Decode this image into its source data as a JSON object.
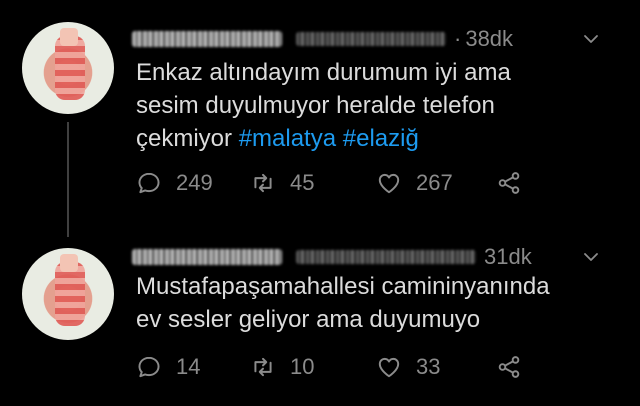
{
  "tweets": [
    {
      "author_name_blurred": "",
      "handle_blurred": "",
      "separator": "·",
      "time": "38dk",
      "text": {
        "line1": "Enkaz altındayım durumum iyi ama",
        "line2": "sesim duyulmuyor heralde telefon",
        "line3_prefix": "çekmiyor ",
        "hashtag1": "#malatya",
        "space": " ",
        "hashtag2": "#elaziğ"
      },
      "replies": "249",
      "retweets": "45",
      "likes": "267"
    },
    {
      "author_name_blurred": "",
      "handle_blurred": "",
      "time": "31dk",
      "text": {
        "line1": "Mustafapaşamahallesi camininyanında",
        "line2": "ev sesler geliyor ama duyumuyo"
      },
      "replies": "14",
      "retweets": "10",
      "likes": "33"
    }
  ],
  "icons": {
    "reply": "reply-icon",
    "retweet": "retweet-icon",
    "like": "heart-icon",
    "share": "share-icon",
    "more": "chevron-down-icon"
  },
  "colors": {
    "background": "#000000",
    "text": "#dcdcdc",
    "muted": "#8b8b8b",
    "hashtag": "#1d9bf0"
  }
}
